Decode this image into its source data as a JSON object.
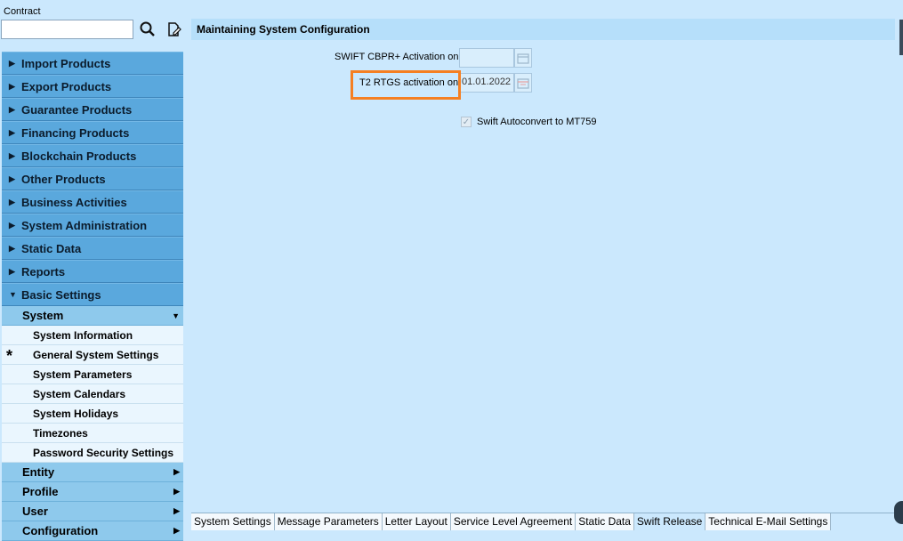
{
  "sidebar": {
    "contract_label": "Contract",
    "contract_value": "",
    "menu": [
      "Import Products",
      "Export Products",
      "Guarantee Products",
      "Financing Products",
      "Blockchain Products",
      "Other Products",
      "Business Activities",
      "System Administration",
      "Static Data",
      "Reports",
      "Basic Settings"
    ],
    "system_header": "System",
    "system_items": [
      "System Information",
      "General System Settings",
      "System Parameters",
      "System Calendars",
      "System Holidays",
      "Timezones",
      "Password Security Settings"
    ],
    "current_marker": "*",
    "lower_items": [
      "Entity",
      "Profile",
      "User",
      "Configuration"
    ]
  },
  "panel": {
    "title": "Maintaining System Configuration",
    "swift_cbpr_label": "SWIFT CBPR+ Activation on",
    "swift_cbpr_value": "",
    "t2_rtgs_label": "T2 RTGS activation on",
    "t2_rtgs_value": "01.01.2022",
    "autoconvert_label": "Swift Autoconvert to MT759",
    "autoconvert_checked": true
  },
  "tabs": [
    "System Settings",
    "Message Parameters",
    "Letter Layout",
    "Service Level Agreement",
    "Static Data",
    "Swift Release",
    "Technical E-Mail Settings"
  ],
  "active_tab": "Swift Release",
  "colors": {
    "highlight": "#f57f22",
    "menu_bg": "#5aa8dd",
    "page_bg": "#cbe8fd"
  }
}
